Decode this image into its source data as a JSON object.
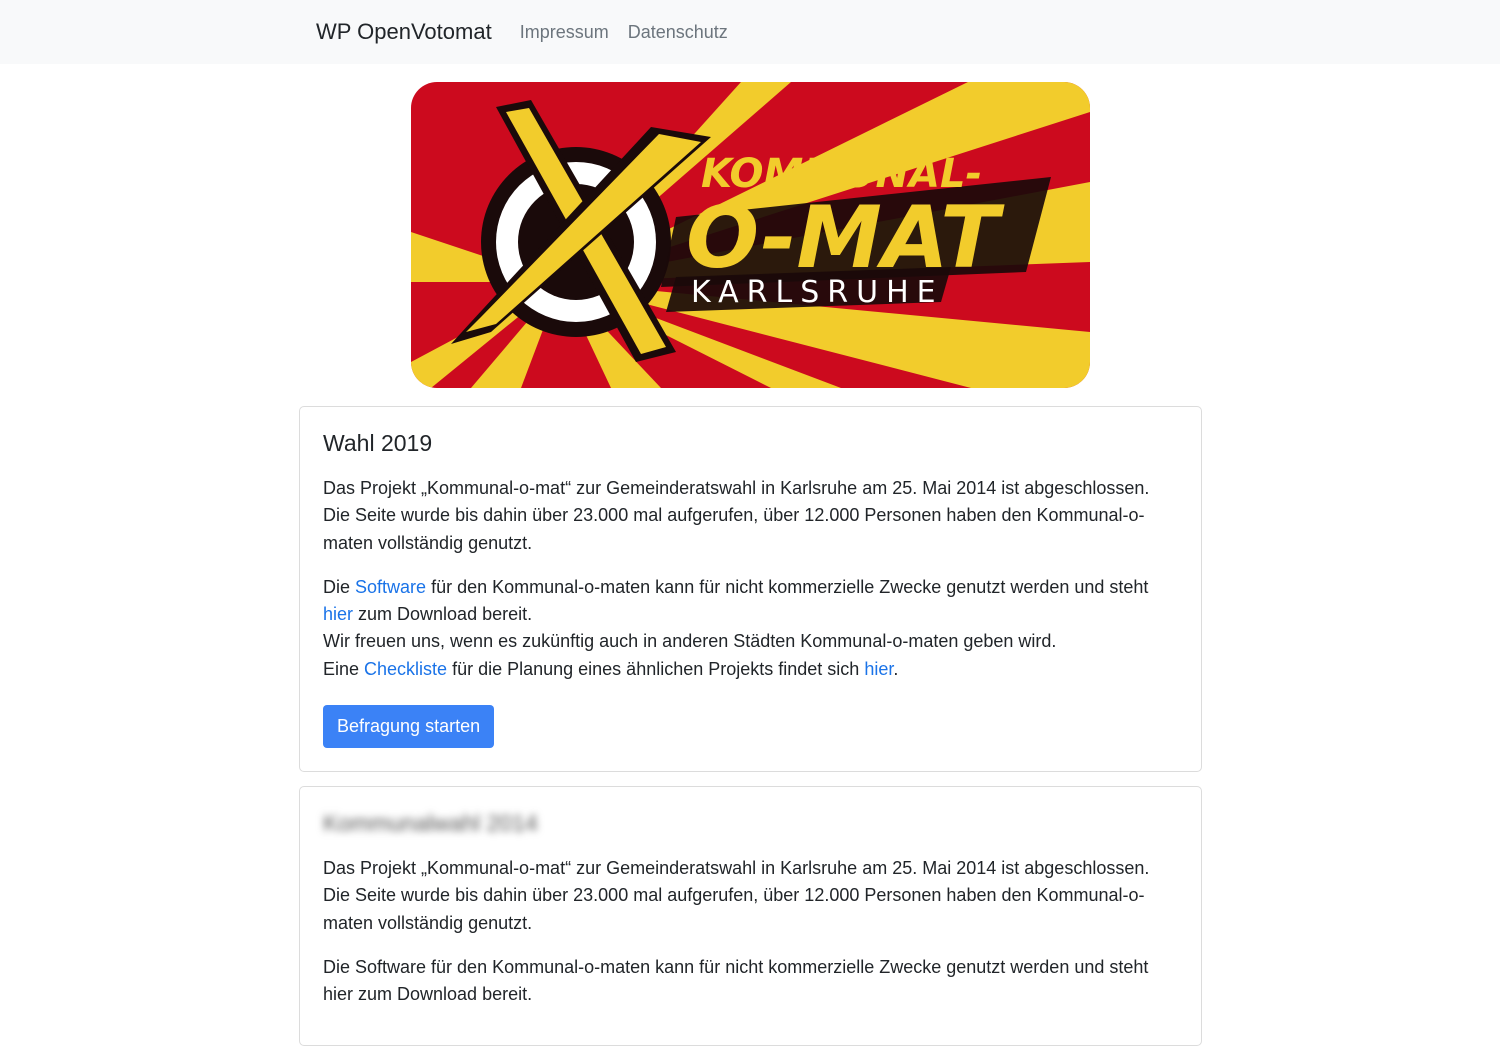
{
  "nav": {
    "brand": "WP OpenVotomat",
    "links": [
      "Impressum",
      "Datenschutz"
    ]
  },
  "banner": {
    "line1": "KOMMUNAL-",
    "line2": "O-MAT",
    "line3": "KARLSRUHE",
    "colors": {
      "red": "#cc0a1e",
      "yellow": "#f2cc2c",
      "black": "#1a0a0a"
    }
  },
  "card1": {
    "title": "Wahl 2019",
    "p1": "Das Projekt „Kommunal-o-mat“ zur Gemeinderatswahl in Karlsruhe am 25. Mai 2014 ist abgeschlossen. Die Seite wurde bis dahin über 23.000 mal aufgerufen, über 12.000 Personen haben den Kommunal-o-maten vollständig genutzt.",
    "p2_a": "Die ",
    "p2_link1": "Software",
    "p2_b": " für den Kommunal-o-maten kann für nicht kommerzielle Zwecke genutzt werden und steht ",
    "p2_link2": "hier",
    "p2_c": " zum Download bereit.",
    "p2_line2": "Wir freuen uns, wenn es zukünftig auch in anderen Städten Kommunal-o-maten geben wird.",
    "p2_d": "Eine ",
    "p2_link3": "Checkliste",
    "p2_e": " für die Planung eines ähnlichen Projekts findet sich ",
    "p2_link4": "hier",
    "p2_f": ".",
    "button": "Befragung starten"
  },
  "card2": {
    "title": "Kommunalwahl 2014",
    "p1": "Das Projekt „Kommunal-o-mat“ zur Gemeinderatswahl in Karlsruhe am 25. Mai 2014 ist abgeschlossen. Die Seite wurde bis dahin über 23.000 mal aufgerufen, über 12.000 Personen haben den Kommunal-o-maten vollständig genutzt.",
    "p2": "Die Software für den Kommunal-o-maten kann für nicht kommerzielle Zwecke genutzt werden und steht hier zum Download bereit."
  }
}
